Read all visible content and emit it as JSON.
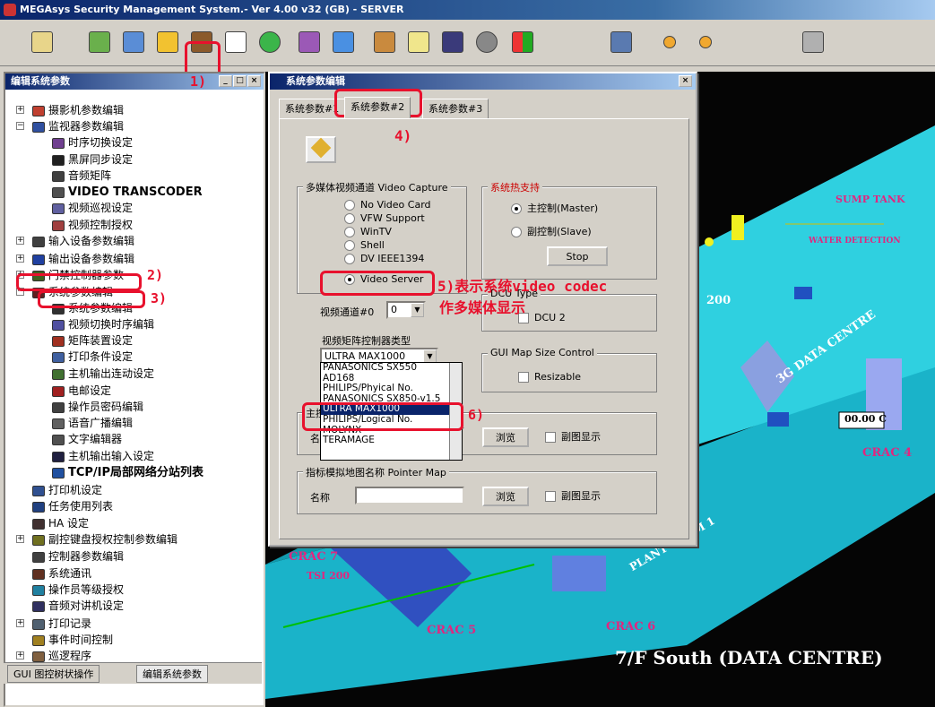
{
  "app": {
    "title": "MEGAsys Security Management System.- Ver 4.00 v32 (GB) - SERVER"
  },
  "annotations": {
    "a1": "1)",
    "a2": "2)",
    "a3": "3)",
    "a4": "4)",
    "a5_line1": "5)表示系统video codec",
    "a5_line2": "作多媒体显示",
    "a6": "6)",
    "color": "#e8112d"
  },
  "left_panel": {
    "title": "编辑系统参数",
    "tree": [
      "摄影机参数编辑",
      "监视器参数编辑",
      "时序切换设定",
      "黑屏同步设定",
      "音频矩阵",
      "VIDEO TRANSCODER",
      "视频巡视设定",
      "视频控制授权",
      "输入设备参数编辑",
      "输出设备参数编辑",
      "门禁控制器参数",
      "系统参数编辑",
      "系统参数编辑",
      "视频切换时序编辑",
      "矩阵装置设定",
      "打印条件设定",
      "主机输出连动设定",
      "电邮设定",
      "操作员密码编辑",
      "语音广播编辑",
      "文字编辑器",
      "主机输出输入设定",
      "TCP/IP局部网络分站列表",
      "打印机设定",
      "任务使用列表",
      "HA 设定",
      "副控键盘授权控制参数编辑",
      "控制器参数编辑",
      "系统通讯",
      "操作员等级授权",
      "音频对讲机设定",
      "打印记录",
      "事件时间控制",
      "巡逻程序"
    ],
    "tabs": [
      "GUI 图控树状操作",
      "编辑系统参数"
    ]
  },
  "dialog": {
    "title": "系统参数编辑",
    "tabs": [
      "系统参数#1",
      "系统参数#2",
      "系统参数#3"
    ],
    "video_capture": {
      "label": "多媒体视频通道 Video Capture",
      "options": [
        "No Video Card",
        "VFW Support",
        "WinTV",
        "Shell",
        "DV IEEE1394",
        "Video Server"
      ],
      "selected": "Video Server"
    },
    "hot_standby": {
      "label": "系统热支持",
      "master": "主控制(Master)",
      "slave": "副控制(Slave)",
      "stop": "Stop"
    },
    "dcu": {
      "label": "DCU Type",
      "option": "DCU 2"
    },
    "channel_label": "视频通道#0",
    "channel_value": "0",
    "matrix_label": "视频矩阵控制器类型",
    "matrix_value": "ULTRA MAX1000",
    "matrix_options": [
      "PANASONICS SX550",
      "AD168",
      "PHILIPS/Phyical No.",
      "PANASONICS SX850-v1.5",
      "ULTRA MAX1000",
      "PHILIPS/Logical No.",
      "MOLYNX",
      "TERAMAGE"
    ],
    "gui_map": {
      "label": "GUI Map Size Control",
      "resizable": "Resizable"
    },
    "main_map": {
      "label": "主控地图 Map",
      "name": "名称",
      "browse": "浏览",
      "subshow": "副图显示"
    },
    "pointer_map": {
      "label": "指标模拟地图名称 Pointer Map",
      "name": "名称",
      "browse": "浏览",
      "subshow": "副图显示"
    }
  },
  "map": {
    "labels": [
      "SUMP TANK",
      "WATER DETECTION",
      "3G DATA CENTRE",
      "CRAC 4",
      "CRAC 7",
      "TSI 200",
      "CRAC 5",
      "CRAC 6",
      "PLANT ROOM 1",
      "200"
    ],
    "temp": "00.00 C",
    "caption": "7/F South (DATA CENTRE)"
  }
}
